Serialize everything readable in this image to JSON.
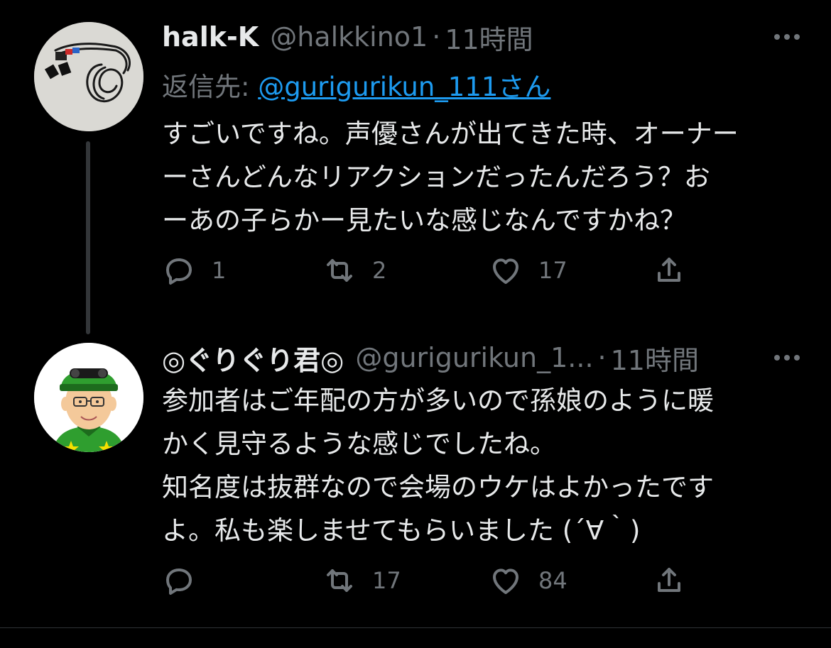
{
  "tweets": [
    {
      "name": "halk-K",
      "handle": "@halkkino1",
      "separator": "·",
      "time": "11時間",
      "replying_prefix": "返信先: ",
      "replying_to": "@guriguri​kun_111さん",
      "text": "すごいですね。声優さんが出てきた時、オーナー\nーさんどんなリアクションだったんだろう？お\nーあの子らかー見たいな感じなんですかね？",
      "reply_count": "1",
      "retweet_count": "2",
      "like_count": "17",
      "avatar_icon": "earphones-photo-icon"
    },
    {
      "name": "◎ぐりぐり君◎",
      "handle": "@guriguri​kun_1...",
      "separator": "·",
      "time": "11時間",
      "text": "参加者はご年配の方が多いので孫娘のように暖\nかく見守るような感じでしたね。\n知名度は抜群なので会場のウケはよかったです\nよ。私も楽しませてもらいました (´∀｀)",
      "reply_count": "",
      "retweet_count": "17",
      "like_count": "84",
      "avatar_icon": "jockey-avatar-icon"
    }
  ],
  "colors": {
    "background": "#000000",
    "text": "#e7e9ea",
    "muted": "#71767b",
    "link": "#1d9bf0"
  }
}
